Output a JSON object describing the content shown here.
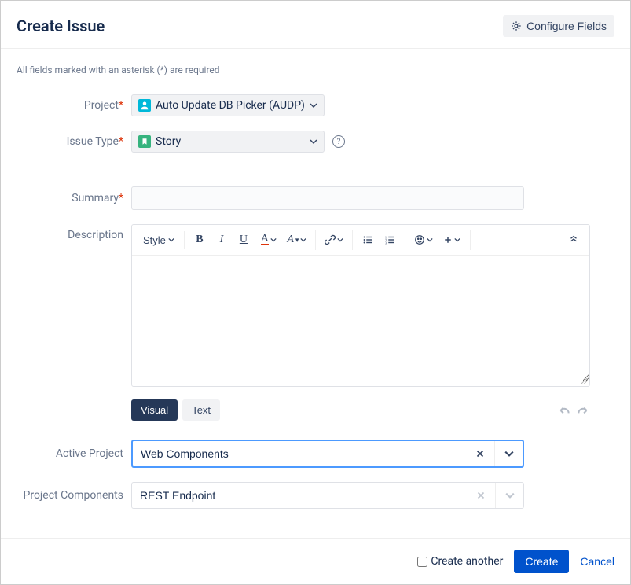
{
  "header": {
    "title": "Create Issue",
    "configure_label": "Configure Fields"
  },
  "notes": {
    "required": "All fields marked with an asterisk (*) are required"
  },
  "labels": {
    "project": "Project",
    "issue_type": "Issue Type",
    "summary": "Summary",
    "description": "Description",
    "active_project": "Active Project",
    "project_components": "Project Components"
  },
  "fields": {
    "project": {
      "value": "Auto Update DB Picker (AUDP)"
    },
    "issue_type": {
      "value": "Story"
    },
    "summary": {
      "value": ""
    },
    "active_project": {
      "value": "Web Components"
    },
    "project_components": {
      "value": "REST Endpoint"
    }
  },
  "rte": {
    "style_label": "Style",
    "tabs": {
      "visual": "Visual",
      "text": "Text"
    }
  },
  "footer": {
    "create_another": "Create another",
    "create": "Create",
    "cancel": "Cancel"
  }
}
